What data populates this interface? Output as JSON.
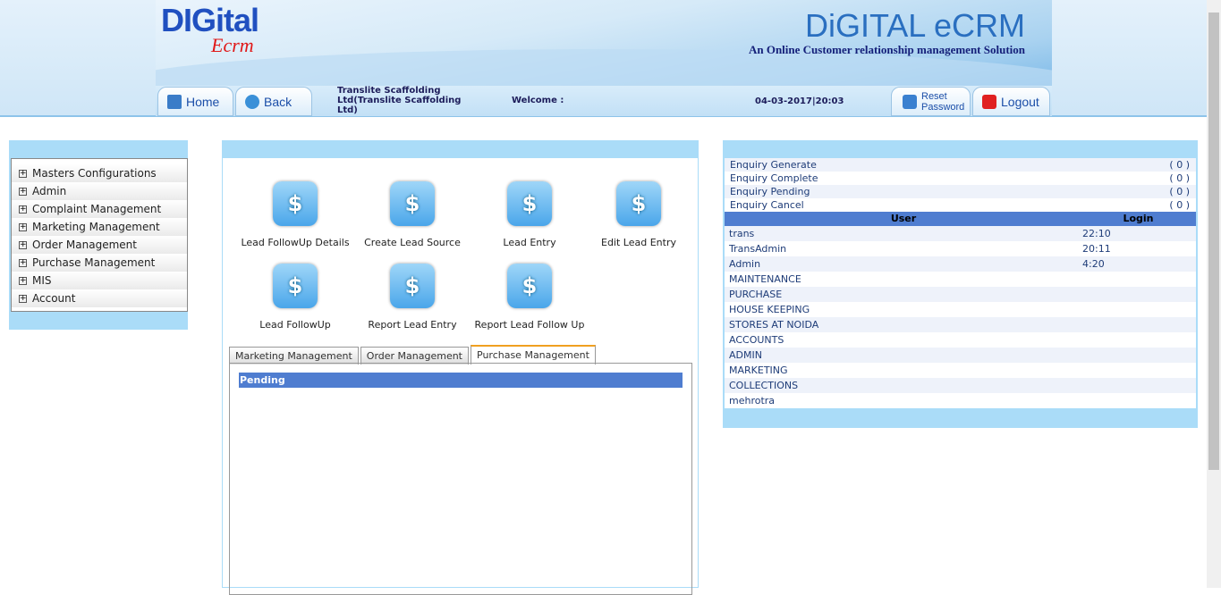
{
  "header": {
    "logo_left": "DIGital",
    "logo_left_sub": "Ecrm",
    "logo_right": "DiGITAL eCRM",
    "tagline": "An Online Customer relationship management Solution",
    "home": "Home",
    "back": "Back",
    "company": "Translite Scaffolding Ltd(Translite Scaffolding Ltd)",
    "welcome": "Welcome :",
    "datetime": "04-03-2017|20:03",
    "reset": "Reset Password",
    "logout": "Logout"
  },
  "sidebar": {
    "items": [
      "Masters Configurations",
      "Admin",
      "Complaint Management",
      "Marketing Management",
      "Order Management",
      "Purchase Management",
      "MIS",
      "Account"
    ]
  },
  "main": {
    "tiles": [
      "Lead FollowUp Details",
      "Create Lead Source",
      "Lead Entry",
      "Edit Lead Entry",
      "Lead FollowUp",
      "Report Lead Entry",
      "Report Lead Follow Up"
    ],
    "tabs": [
      "Marketing Management",
      "Order Management",
      "Purchase Management"
    ],
    "active_tab": "Purchase Management",
    "pending": "Pending"
  },
  "right": {
    "enquiries": [
      {
        "label": "Enquiry Generate",
        "count": "( 0 )"
      },
      {
        "label": "Enquiry Complete",
        "count": "( 0 )"
      },
      {
        "label": "Enquiry Pending",
        "count": "( 0 )"
      },
      {
        "label": "Enquiry Cancel",
        "count": "( 0 )"
      }
    ],
    "user_header": "User",
    "login_header": "Login",
    "users": [
      {
        "name": "trans",
        "login": "22:10"
      },
      {
        "name": "TransAdmin",
        "login": "20:11"
      },
      {
        "name": "Admin",
        "login": "4:20"
      },
      {
        "name": "MAINTENANCE",
        "login": ""
      },
      {
        "name": "PURCHASE",
        "login": ""
      },
      {
        "name": "HOUSE KEEPING",
        "login": ""
      },
      {
        "name": "STORES AT NOIDA",
        "login": ""
      },
      {
        "name": "ACCOUNTS",
        "login": ""
      },
      {
        "name": "ADMIN",
        "login": ""
      },
      {
        "name": "MARKETING",
        "login": ""
      },
      {
        "name": "COLLECTIONS",
        "login": ""
      },
      {
        "name": "mehrotra",
        "login": ""
      }
    ]
  }
}
